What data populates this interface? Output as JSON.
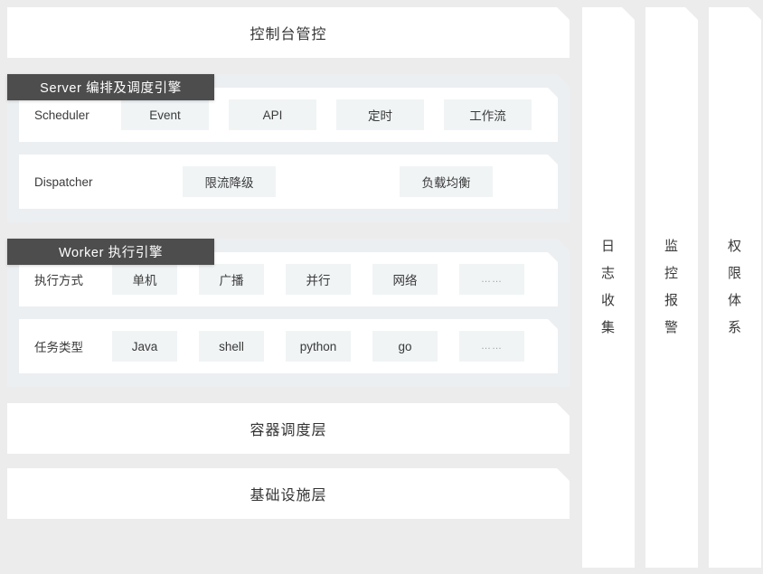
{
  "diagram": {
    "title_band_top": "控制台管控",
    "bottom_bands": [
      "容器调度层",
      "基础设施层"
    ],
    "sections": [
      {
        "tab": "Server 编排及调度引擎",
        "rows": [
          {
            "label": "Scheduler",
            "chips": [
              "Event",
              "API",
              "定时",
              "工作流"
            ]
          },
          {
            "label": "Dispatcher",
            "chips": [
              "限流降级",
              "负载均衡"
            ]
          }
        ]
      },
      {
        "tab": "Worker 执行引擎",
        "rows": [
          {
            "label": "执行方式",
            "chips": [
              "单机",
              "广播",
              "并行",
              "网络",
              "……"
            ]
          },
          {
            "label": "任务类型",
            "chips": [
              "Java",
              "shell",
              "python",
              "go",
              "……"
            ]
          }
        ]
      }
    ],
    "side_columns": [
      {
        "text": "日志收集",
        "chars": [
          "日",
          "志",
          "收",
          "集"
        ]
      },
      {
        "text": "监控报警",
        "chars": [
          "监",
          "控",
          "报",
          "警"
        ]
      },
      {
        "text": "权限体系",
        "chars": [
          "权",
          "限",
          "体",
          "系"
        ]
      }
    ],
    "colors": {
      "page_background": "#ececec",
      "panel_background": "#eceff1",
      "card_background": "#ffffff",
      "chip_background": "#f0f4f5",
      "tab_background": "#4d4d4d",
      "text": "#3a3a3a"
    }
  }
}
